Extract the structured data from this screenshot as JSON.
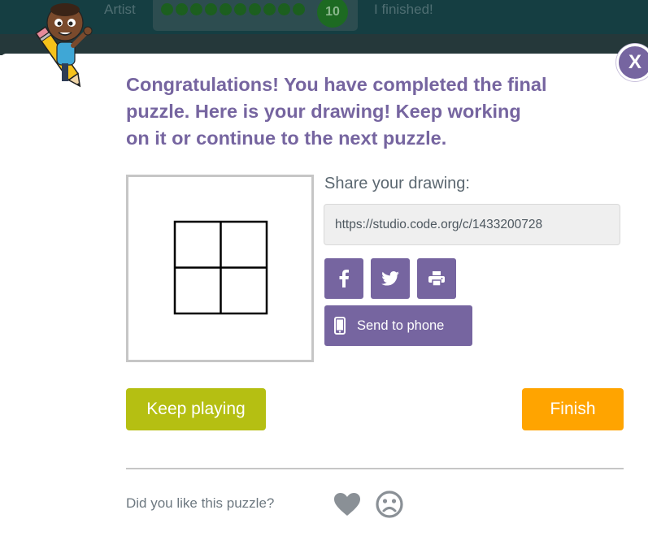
{
  "header": {
    "artist_label": "Artist",
    "level_number": "10",
    "finished_text": "I finished!"
  },
  "modal": {
    "close_label": "X",
    "message": "Congratulations! You have completed the final\npuzzle. Here is your drawing! Keep working\non it or continue to the next puzzle.",
    "share": {
      "label": "Share your drawing:",
      "url": "https://studio.code.org/c/1433200728",
      "send_to_phone_label": "Send to phone",
      "facebook_icon": "facebook-icon",
      "twitter_icon": "twitter-icon",
      "print_icon": "print-icon"
    },
    "keep_playing_label": "Keep playing",
    "finish_label": "Finish",
    "feedback": {
      "question": "Did you like this puzzle?",
      "like_icon": "heart-icon",
      "dislike_icon": "frown-icon"
    }
  },
  "colors": {
    "purple": "#7665a0",
    "keep_playing_green": "#b5bf12",
    "finish_orange": "#ffa400",
    "header_teal": "#153e42"
  }
}
